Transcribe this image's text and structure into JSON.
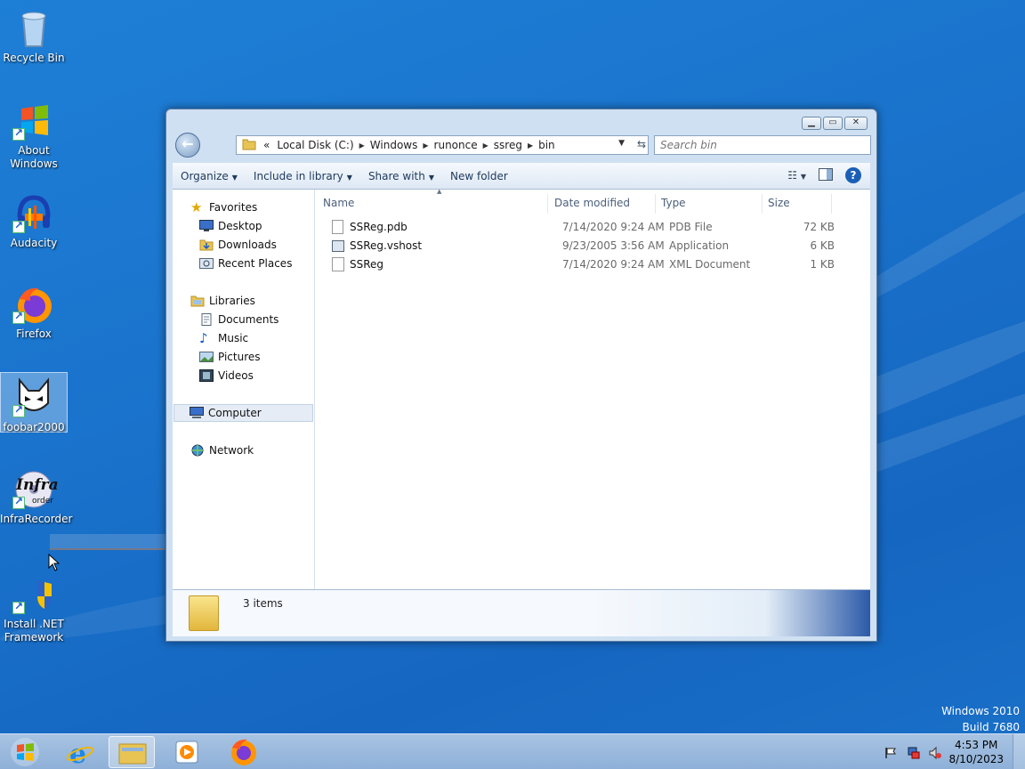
{
  "desktop": {
    "icons": [
      {
        "label": "Recycle Bin",
        "icon": "recycle-bin-icon"
      },
      {
        "label": "About Windows",
        "icon": "windows-logo-icon"
      },
      {
        "label": "Audacity",
        "icon": "audacity-icon"
      },
      {
        "label": "Firefox",
        "icon": "firefox-icon"
      },
      {
        "label": "foobar2000",
        "icon": "foobar2000-icon"
      },
      {
        "label": "InfraRecorder",
        "icon": "infrarecorder-icon"
      },
      {
        "label": "Install .NET Framework",
        "icon": "dotnet-installer-icon"
      }
    ],
    "infra_logo_text": "Infra",
    "infra_logo_sub": "order",
    "watermark_line1": "Windows 2010",
    "watermark_line2": "Build 7680"
  },
  "explorer": {
    "address": {
      "overflow": "«",
      "crumbs": [
        "Local Disk (C:)",
        "Windows",
        "runonce",
        "ssreg",
        "bin"
      ]
    },
    "search_placeholder": "Search bin",
    "toolbar": {
      "organize": "Organize",
      "include_in_library": "Include in library",
      "share_with": "Share with",
      "new_folder": "New folder"
    },
    "nav": {
      "favorites": "Favorites",
      "desktop": "Desktop",
      "downloads": "Downloads",
      "recent_places": "Recent Places",
      "libraries": "Libraries",
      "documents": "Documents",
      "music": "Music",
      "pictures": "Pictures",
      "videos": "Videos",
      "computer": "Computer",
      "network": "Network"
    },
    "columns": {
      "name": "Name",
      "date_modified": "Date modified",
      "type": "Type",
      "size": "Size"
    },
    "files": [
      {
        "name": "SSReg.pdb",
        "date": "7/14/2020 9:24 AM",
        "type": "PDB File",
        "size": "72 KB"
      },
      {
        "name": "SSReg.vshost",
        "date": "9/23/2005 3:56 AM",
        "type": "Application",
        "size": "6 KB"
      },
      {
        "name": "SSReg",
        "date": "7/14/2020 9:24 AM",
        "type": "XML Document",
        "size": "1 KB"
      }
    ],
    "status": "3 items"
  },
  "taskbar": {
    "time": "4:53 PM",
    "date": "8/10/2023"
  },
  "colors": {
    "desktop_bg": "#1a73cc",
    "window_frame": "#cfe0f2",
    "link_text": "#1e395b"
  }
}
